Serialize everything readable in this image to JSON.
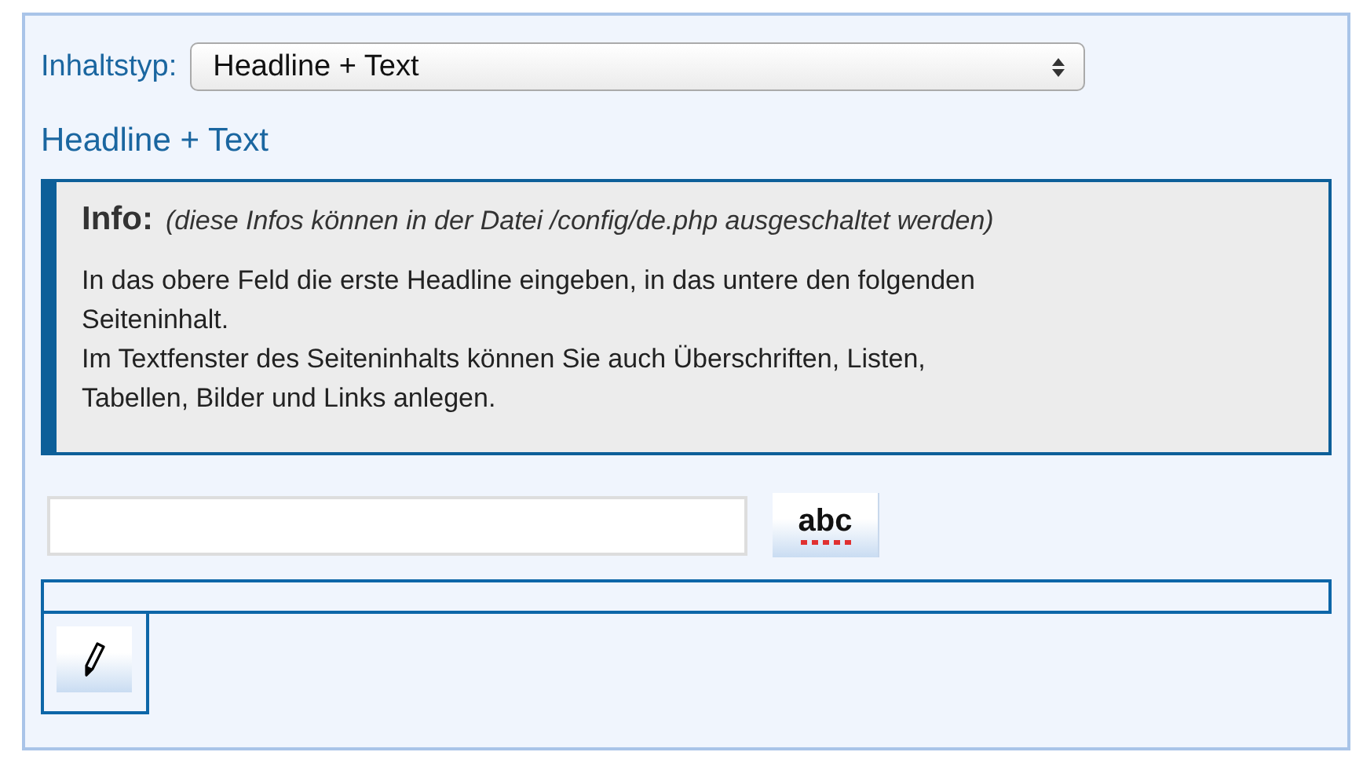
{
  "content_type": {
    "label": "Inhaltstyp:",
    "value": "Headline + Text"
  },
  "heading": "Headline + Text",
  "info": {
    "title": "Info:",
    "note": "(diese Infos können in der Datei /config/de.php ausgeschaltet werden)",
    "paragraphs": [
      "In das obere Feld die erste Headline eingeben, in das untere den folgenden Seiteninhalt.",
      "Im Textfenster des Seiteninhalts können Sie auch Überschriften, Listen, Tabellen, Bilder und Links anlegen."
    ]
  },
  "spellcheck_button": "abc"
}
